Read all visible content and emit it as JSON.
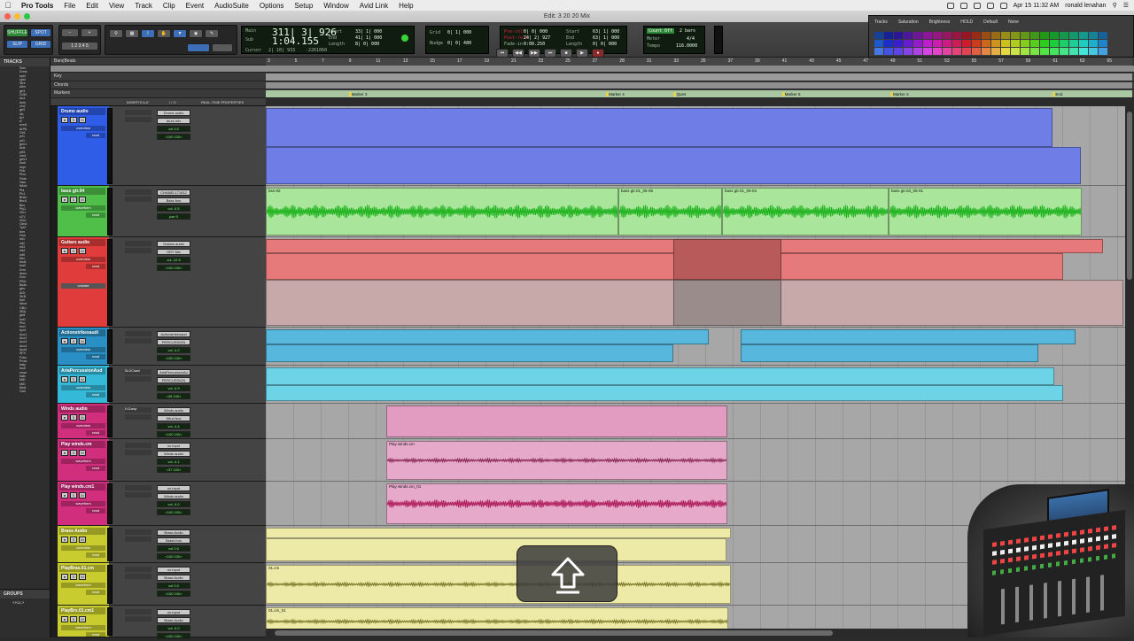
{
  "menubar": {
    "app": "Pro Tools",
    "items": [
      "File",
      "Edit",
      "View",
      "Track",
      "Clip",
      "Event",
      "AudioSuite",
      "Options",
      "Setup",
      "Window",
      "Avid Link",
      "Help"
    ],
    "datetime": "Apr 15  11:32 AM",
    "user": "ronald lenahan"
  },
  "window": {
    "title": "Edit: 3 20 20 Mix"
  },
  "toolbar": {
    "modes": [
      "SHUFFLE",
      "SPOT",
      "SLIP",
      "GRID"
    ],
    "main_counter_label": "Main",
    "main_counter": "311| 3| 926",
    "sub_counter_label": "Sub",
    "sub_counter": "1:04.155",
    "start_label": "Start",
    "end_label": "End",
    "length_label": "Length",
    "start": "33| 1| 000",
    "end": "41| 1| 000",
    "length": "8| 0| 000",
    "cursor_label": "Cursor",
    "cursor": "2| 10| 933",
    "cursor_db": "-2261060",
    "grid_label": "Grid",
    "grid": "0| 1| 000",
    "nudge_label": "Nudge",
    "nudge": "0| 0| 480",
    "preroll_label": "Pre-roll",
    "postroll_label": "Post-roll",
    "fadein_label": "Fade-in",
    "preroll": "0| 0| 000",
    "postroll": "24| 2| 927",
    "fadein": "0:00.250",
    "transport_start": "63| 1| 000",
    "transport_end": "63| 1| 000",
    "transport_length": "0| 0| 000",
    "countoff": "Count Off",
    "meter_label": "Meter",
    "tempo_label": "Tempo",
    "bars": "2 bars",
    "meter": "4/4",
    "tempo": "116.0000"
  },
  "palette": {
    "tabs": [
      "Tracks",
      "Saturation",
      "Brightness",
      "HOLD",
      "Default",
      "None"
    ]
  },
  "tracklist": {
    "header": "TRACKS",
    "items": [
      "Sum",
      "Drms",
      "spt4",
      "spt4",
      "Strs",
      "Altm",
      "gtr3",
      "2150",
      "Ac4",
      "Actn",
      "cln2",
      "gtr2",
      "ldc",
      "Arf",
      "t2",
      "wnrt1",
      "ArPA",
      "Ctr1",
      "prl1",
      "prl1",
      "grm1",
      "Aria",
      "pl01",
      "ctm1",
      "grm1",
      "bsdr",
      "impr",
      "Fldr",
      "Plcu",
      "Flute",
      "Hsw",
      "Wind",
      "Pla",
      "Pn1",
      "Brsm",
      "BnrA",
      "Bsn",
      "Ply1",
      "Vln1",
      "xCV",
      "Vlnd",
      "Clmd",
      "Tpt2",
      "brm",
      "Hrnt",
      "mt1",
      "mt2",
      "mt3",
      "mt4",
      "mt5",
      "Mxr",
      "tnst1",
      "bst3",
      "Drm",
      "drms",
      "Drm",
      "PBU",
      "Bsds",
      "gtrs",
      "AGt",
      "StrB",
      "bsfl",
      "Wind",
      "OBU",
      "SBU",
      "gtr8",
      "hnt1",
      "Pho",
      "rev1",
      "bynt",
      "Aux1",
      "Aux2",
      "Aux3",
      "Aux4",
      "Aux5",
      "SFX",
      "Fcbs",
      "Prow",
      "baty",
      "bsdr",
      "smar",
      "hats",
      "MID",
      "MID",
      "Mst1",
      "Clck"
    ]
  },
  "groups": {
    "header": "GROUPS",
    "all": "<ALL>"
  },
  "rulers": {
    "bars_label": "Bars|Beats",
    "key_label": "Key",
    "chords_label": "Chords",
    "markers_label": "Markers",
    "bar_numbers": [
      "3",
      "5",
      "7",
      "9",
      "11",
      "13",
      "15",
      "17",
      "19",
      "21",
      "23",
      "25",
      "27",
      "28",
      "31",
      "33",
      "35",
      "37",
      "39",
      "41",
      "43",
      "45",
      "47",
      "49",
      "51",
      "53",
      "55",
      "57",
      "59",
      "61",
      "63",
      "65"
    ],
    "markers": [
      {
        "name": "Marker 3",
        "bar": 9
      },
      {
        "name": "Marker 4",
        "bar": 28
      },
      {
        "name": "Quiet",
        "bar": 33
      },
      {
        "name": "Marker 6",
        "bar": 41
      },
      {
        "name": "Marker 2",
        "bar": 49
      },
      {
        "name": "End",
        "bar": 61
      }
    ]
  },
  "columns": {
    "inserts": "INSERTS A-E",
    "io": "I / O",
    "rtp": "REAL-TIME PROPERTIES"
  },
  "tracks": [
    {
      "name": "Drums audio",
      "color": "#2f5de8",
      "clip_color": "#6f7ee6",
      "io": [
        "Drums audio",
        "drum mix"
      ],
      "vol": "vol 0.0",
      "pan": "<100 100>",
      "view": "overview",
      "mode": "read"
    },
    {
      "name": "bass gtr.04",
      "color": "#4fbf4a",
      "clip_color": "#a9e59a",
      "io": [
        "CHANEL171812",
        "Bass bus"
      ],
      "vol": "vol -0.5",
      "pan": "pan 0",
      "view": "waveform",
      "mode": "read"
    },
    {
      "name": "Guitars audio",
      "color": "#e03c3c",
      "clip_color": "#e67a7a",
      "io": [
        "Guitars audio",
        "GRT Mix"
      ],
      "vol": "vol -12.5",
      "pan": "<100 100>",
      "view": "overview",
      "mode": "read",
      "sub_view": "volume"
    },
    {
      "name": "Actionstrikesaudi",
      "color": "#2a8fc4",
      "clip_color": "#57b7dc",
      "io": [
        "Actionstrikesaud",
        "PERCUSSION"
      ],
      "vol": "vol -4.2",
      "pan": "<100 100>",
      "view": "overview",
      "mode": "read"
    },
    {
      "name": "AriaPercussionAud",
      "color": "#35b9d8",
      "clip_color": "#6dd3e6",
      "io": [
        "AriaPercussionAu",
        "PERCUSSION"
      ],
      "vol": "vol -0.9",
      "pan": "<28 100>",
      "view": "overview",
      "mode": "read",
      "insert": "SLGChanl"
    },
    {
      "name": "Winds audio",
      "color": "#d12f7e",
      "clip_color": "#e29bc1",
      "io": [
        "Winds audio",
        "Wind bus"
      ],
      "vol": "vol -4.4",
      "pan": "<100 100>",
      "view": "overview",
      "mode": "read",
      "insert": "H-Comp"
    },
    {
      "name": "Play winds.cm",
      "color": "#d12f7e",
      "clip_color": "#e6a9ca",
      "io": [
        "no input",
        "Winds audio"
      ],
      "vol": "vol -4.1",
      "pan": "<37 100>",
      "view": "waveform",
      "mode": "read"
    },
    {
      "name": "Play winds.cm1",
      "color": "#d12f7e",
      "clip_color": "#e6a9ca",
      "io": [
        "no input",
        "Winds audio"
      ],
      "vol": "vol -0.0",
      "pan": "<100 100>",
      "view": "waveform",
      "mode": "read"
    },
    {
      "name": "Brass Audio",
      "color": "#c9cc2e",
      "clip_color": "#eceaa6",
      "io": [
        "Brass Audio",
        "Brass bus"
      ],
      "vol": "vol 0.0",
      "pan": "<100 100>",
      "view": "overview",
      "mode": "read"
    },
    {
      "name": "PlayBras.01.cm",
      "color": "#c9cc2e",
      "clip_color": "#eceaa6",
      "io": [
        "no input",
        "Brass Audio"
      ],
      "vol": "vol 0.0",
      "pan": "<100 100>",
      "view": "waveform",
      "mode": "read"
    },
    {
      "name": "PlayBrs.01.cm1",
      "color": "#c9cc2e",
      "clip_color": "#eceaa6",
      "io": [
        "no input",
        "Brass Audio"
      ],
      "vol": "vol -0.0",
      "pan": "<100 100>",
      "view": "waveform",
      "mode": "read"
    }
  ],
  "clips": {
    "bass": [
      "bss-02",
      "bass gtr.01_05-05",
      "bass gtr.01_05-04",
      "bass gtr.03_05-01"
    ],
    "winds1": "Play winds.cm",
    "winds2": "Play winds.cm_01",
    "brass1": "01.cm",
    "brass2": "01.cm_01"
  },
  "overlay": {
    "icon": "upload-arrow-icon"
  }
}
